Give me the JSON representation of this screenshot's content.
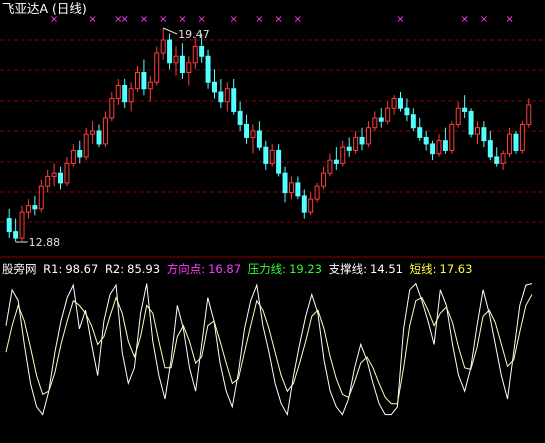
{
  "title": "飞亚达A (日线)",
  "chart_data": [
    {
      "type": "candlestick",
      "title": "飞亚达A (日线)",
      "colors": {
        "up": "#ff3c3c",
        "down": "#54ffff",
        "marker": "#ff40ff",
        "gridline": "#8b0000"
      },
      "high_label": "19.47",
      "low_label": "12.88",
      "signal_marker": "×",
      "ohlc": [
        [
          13.6,
          13.9,
          13.0,
          13.2
        ],
        [
          13.2,
          13.6,
          12.88,
          13.0
        ],
        [
          13.0,
          14.0,
          12.9,
          13.8
        ],
        [
          13.8,
          14.2,
          13.6,
          14.0
        ],
        [
          14.0,
          14.3,
          13.7,
          13.9
        ],
        [
          13.9,
          14.8,
          13.8,
          14.6
        ],
        [
          14.6,
          15.1,
          14.4,
          14.9
        ],
        [
          14.9,
          15.3,
          14.6,
          15.0
        ],
        [
          15.0,
          15.2,
          14.5,
          14.7
        ],
        [
          14.7,
          15.5,
          14.6,
          15.3
        ],
        [
          15.3,
          15.9,
          15.2,
          15.7
        ],
        [
          15.7,
          16.0,
          15.3,
          15.5
        ],
        [
          15.5,
          16.4,
          15.4,
          16.2
        ],
        [
          16.2,
          16.6,
          15.9,
          16.3
        ],
        [
          16.3,
          16.5,
          15.8,
          15.9
        ],
        [
          15.9,
          16.9,
          15.8,
          16.7
        ],
        [
          16.7,
          17.5,
          16.6,
          17.3
        ],
        [
          17.3,
          17.9,
          17.1,
          17.7
        ],
        [
          17.7,
          17.9,
          17.0,
          17.2
        ],
        [
          17.2,
          17.8,
          16.9,
          17.6
        ],
        [
          17.6,
          18.3,
          17.5,
          18.1
        ],
        [
          18.1,
          18.5,
          17.4,
          17.6
        ],
        [
          17.6,
          18.0,
          17.2,
          17.8
        ],
        [
          17.8,
          18.9,
          17.7,
          18.7
        ],
        [
          18.7,
          19.47,
          18.5,
          19.1
        ],
        [
          19.1,
          19.3,
          18.2,
          18.4
        ],
        [
          18.4,
          18.9,
          18.0,
          18.6
        ],
        [
          18.6,
          19.0,
          17.9,
          18.1
        ],
        [
          18.1,
          18.6,
          17.7,
          18.4
        ],
        [
          18.4,
          19.2,
          18.2,
          18.9
        ],
        [
          18.9,
          19.3,
          18.4,
          18.6
        ],
        [
          18.6,
          18.8,
          17.6,
          17.8
        ],
        [
          17.8,
          18.2,
          17.3,
          17.5
        ],
        [
          17.5,
          17.9,
          17.0,
          17.2
        ],
        [
          17.2,
          17.8,
          16.9,
          17.6
        ],
        [
          17.6,
          17.9,
          16.8,
          16.9
        ],
        [
          16.9,
          17.2,
          16.3,
          16.5
        ],
        [
          16.5,
          16.8,
          15.9,
          16.1
        ],
        [
          16.1,
          16.5,
          15.6,
          16.3
        ],
        [
          16.3,
          16.6,
          15.7,
          15.8
        ],
        [
          15.8,
          16.0,
          15.1,
          15.3
        ],
        [
          15.3,
          15.9,
          15.2,
          15.7
        ],
        [
          15.7,
          15.9,
          14.9,
          15.0
        ],
        [
          15.0,
          15.2,
          14.1,
          14.4
        ],
        [
          14.4,
          14.9,
          14.2,
          14.7
        ],
        [
          14.7,
          14.9,
          14.2,
          14.3
        ],
        [
          14.3,
          14.5,
          13.6,
          13.8
        ],
        [
          13.8,
          14.4,
          13.7,
          14.2
        ],
        [
          14.2,
          14.7,
          14.1,
          14.6
        ],
        [
          14.6,
          15.2,
          14.5,
          15.0
        ],
        [
          15.0,
          15.6,
          14.9,
          15.4
        ],
        [
          15.4,
          15.8,
          15.1,
          15.3
        ],
        [
          15.3,
          16.0,
          15.2,
          15.8
        ],
        [
          15.8,
          16.1,
          15.5,
          15.7
        ],
        [
          15.7,
          16.3,
          15.6,
          16.1
        ],
        [
          16.1,
          16.4,
          15.7,
          15.9
        ],
        [
          15.9,
          16.6,
          15.8,
          16.4
        ],
        [
          16.4,
          16.9,
          16.3,
          16.7
        ],
        [
          16.7,
          17.0,
          16.4,
          16.6
        ],
        [
          16.6,
          17.2,
          16.5,
          17.0
        ],
        [
          17.0,
          17.4,
          16.8,
          17.3
        ],
        [
          17.3,
          17.5,
          16.9,
          17.0
        ],
        [
          17.0,
          17.3,
          16.6,
          16.8
        ],
        [
          16.8,
          17.0,
          16.3,
          16.4
        ],
        [
          16.4,
          16.7,
          16.0,
          16.1
        ],
        [
          16.1,
          16.3,
          15.7,
          15.9
        ],
        [
          15.9,
          16.0,
          15.4,
          15.6
        ],
        [
          15.6,
          16.2,
          15.5,
          16.0
        ],
        [
          16.0,
          16.4,
          15.6,
          15.7
        ],
        [
          15.7,
          16.6,
          15.6,
          16.5
        ],
        [
          16.5,
          17.2,
          16.4,
          17.0
        ],
        [
          17.0,
          17.4,
          16.7,
          16.9
        ],
        [
          16.9,
          17.0,
          16.1,
          16.2
        ],
        [
          16.2,
          16.6,
          15.9,
          16.4
        ],
        [
          16.4,
          16.6,
          15.8,
          16.0
        ],
        [
          16.0,
          16.3,
          15.4,
          15.5
        ],
        [
          15.5,
          15.8,
          15.2,
          15.3
        ],
        [
          15.3,
          15.7,
          15.1,
          15.6
        ],
        [
          15.6,
          16.4,
          15.5,
          16.2
        ],
        [
          16.2,
          16.3,
          15.6,
          15.7
        ],
        [
          15.7,
          16.6,
          15.6,
          16.5
        ],
        [
          16.5,
          17.3,
          16.4,
          17.1
        ]
      ]
    },
    {
      "type": "line",
      "title": "股旁网",
      "items": [
        {
          "label": "R1:",
          "value": "98.67"
        },
        {
          "label": "R2:",
          "value": "85.93"
        },
        {
          "label": "方向点:",
          "value": "16.87"
        },
        {
          "label": "压力线:",
          "value": "19.23"
        },
        {
          "label": "支撑线:",
          "value": "14.51"
        },
        {
          "label": "短线:",
          "value": "17.63"
        }
      ],
      "series": [
        {
          "name": "R1",
          "color": "#ffffff",
          "values": [
            72,
            95,
            88,
            60,
            35,
            20,
            15,
            30,
            55,
            75,
            90,
            98,
            70,
            82,
            60,
            40,
            75,
            92,
            98,
            55,
            35,
            45,
            80,
            99,
            62,
            40,
            25,
            50,
            85,
            70,
            45,
            30,
            60,
            90,
            75,
            48,
            30,
            20,
            42,
            70,
            88,
            98,
            72,
            55,
            35,
            22,
            15,
            40,
            60,
            78,
            92,
            80,
            50,
            30,
            20,
            15,
            25,
            45,
            60,
            50,
            35,
            22,
            15,
            15,
            20,
            70,
            95,
            99,
            88,
            75,
            60,
            95,
            85,
            60,
            40,
            30,
            45,
            72,
            95,
            80,
            60,
            40,
            25,
            55,
            85,
            98,
            99
          ]
        },
        {
          "name": "R2",
          "color": "#ffffc0",
          "values": [
            55,
            72,
            85,
            75,
            58,
            40,
            28,
            30,
            42,
            60,
            75,
            88,
            85,
            80,
            72,
            60,
            65,
            78,
            90,
            80,
            62,
            52,
            65,
            85,
            80,
            62,
            45,
            45,
            65,
            72,
            62,
            48,
            52,
            72,
            75,
            62,
            48,
            35,
            38,
            55,
            72,
            88,
            82,
            70,
            55,
            40,
            30,
            35,
            48,
            62,
            78,
            82,
            70,
            52,
            38,
            28,
            26,
            36,
            48,
            52,
            45,
            35,
            26,
            22,
            22,
            45,
            72,
            88,
            90,
            82,
            72,
            80,
            84,
            74,
            58,
            45,
            44,
            58,
            78,
            82,
            74,
            60,
            46,
            50,
            68,
            85,
            92
          ]
        }
      ]
    }
  ]
}
